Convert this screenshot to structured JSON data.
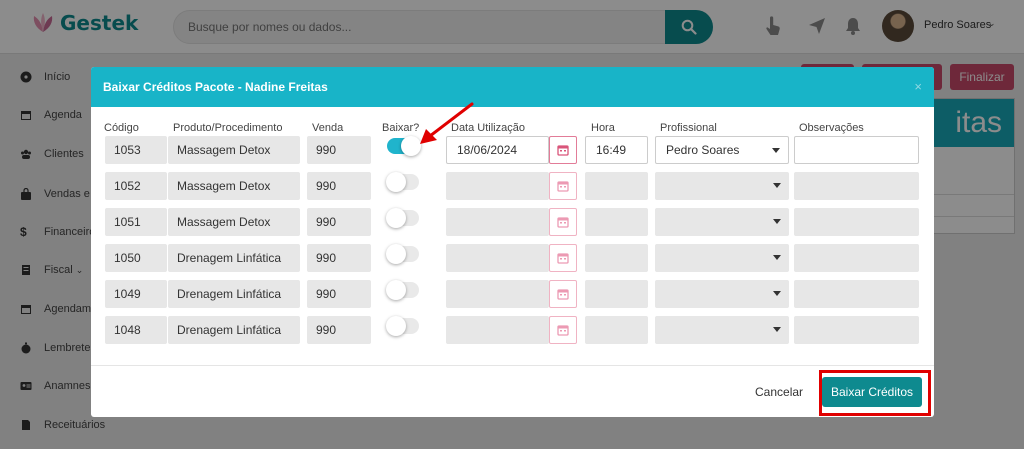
{
  "app": {
    "logo_text": "Gestek",
    "brand_color": "#0e8a8f",
    "accent_color": "#18b4c8"
  },
  "header": {
    "search_placeholder": "Busque por nomes ou dados...",
    "search_icon": "search-icon",
    "icons": [
      "touch-icon",
      "send-icon",
      "bell-icon"
    ],
    "user_name": "Pedro Soares"
  },
  "sidebar": {
    "items": [
      {
        "label": "Início",
        "icon": "dashboard-icon"
      },
      {
        "label": "Agenda",
        "icon": "calendar-icon"
      },
      {
        "label": "Clientes",
        "icon": "users-icon"
      },
      {
        "label": "Vendas e C",
        "icon": "bag-icon"
      },
      {
        "label": "Financeiro",
        "icon": "dollar-icon"
      },
      {
        "label": "Fiscal",
        "icon": "receipt-icon"
      },
      {
        "label": "Agendame",
        "icon": "calendar-icon"
      },
      {
        "label": "Lembretes",
        "icon": "stopwatch-icon"
      },
      {
        "label": "Anamnese",
        "icon": "id-card-icon"
      },
      {
        "label": "Receituários",
        "icon": "file-icon"
      }
    ]
  },
  "background_page": {
    "finalizar_label": "Finalizar",
    "card_title_fragment": "itas"
  },
  "modal": {
    "title": "Baixar Créditos Pacote - Nadine Freitas",
    "close_symbol": "×",
    "columns": {
      "codigo": "Código",
      "produto": "Produto/Procedimento",
      "venda": "Venda",
      "baixar": "Baixar?",
      "data": "Data Utilização",
      "hora": "Hora",
      "profissional": "Profissional",
      "observacoes": "Observações"
    },
    "rows": [
      {
        "codigo": "1053",
        "produto": "Massagem Detox",
        "venda": "990",
        "baixar": true,
        "data": "18/06/2024",
        "hora": "16:49",
        "profissional": "Pedro Soares",
        "observacoes": ""
      },
      {
        "codigo": "1052",
        "produto": "Massagem Detox",
        "venda": "990",
        "baixar": false,
        "data": "",
        "hora": "",
        "profissional": "",
        "observacoes": ""
      },
      {
        "codigo": "1051",
        "produto": "Massagem Detox",
        "venda": "990",
        "baixar": false,
        "data": "",
        "hora": "",
        "profissional": "",
        "observacoes": ""
      },
      {
        "codigo": "1050",
        "produto": "Drenagem Linfática",
        "venda": "990",
        "baixar": false,
        "data": "",
        "hora": "",
        "profissional": "",
        "observacoes": ""
      },
      {
        "codigo": "1049",
        "produto": "Drenagem Linfática",
        "venda": "990",
        "baixar": false,
        "data": "",
        "hora": "",
        "profissional": "",
        "observacoes": ""
      },
      {
        "codigo": "1048",
        "produto": "Drenagem Linfática",
        "venda": "990",
        "baixar": false,
        "data": "",
        "hora": "",
        "profissional": "",
        "observacoes": ""
      }
    ],
    "cancel_label": "Cancelar",
    "submit_label": "Baixar Créditos"
  },
  "annotations": {
    "highlight_color": "#e00000"
  }
}
